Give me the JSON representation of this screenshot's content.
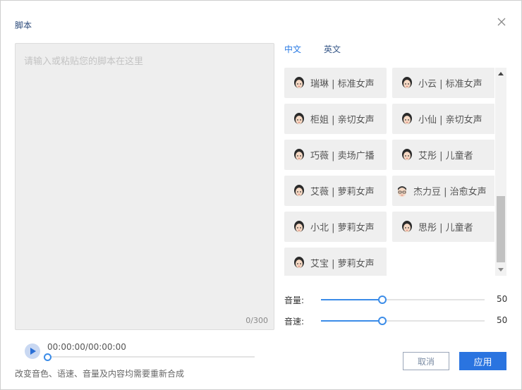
{
  "dialog": {
    "title": "脚本",
    "close_icon": "close-icon"
  },
  "script": {
    "placeholder": "请输入或粘贴您的脚本在这里",
    "value": "",
    "char_count": "0/300"
  },
  "languages": {
    "tabs": [
      "中文",
      "英文"
    ],
    "selected": "中文"
  },
  "voices": [
    {
      "label": "瑞琳 | 标准女声",
      "avatar": "female-avatar-icon"
    },
    {
      "label": "小云 | 标准女声",
      "avatar": "female-avatar-icon"
    },
    {
      "label": "柜姐 | 亲切女声",
      "avatar": "female-avatar-icon"
    },
    {
      "label": "小仙 | 亲切女声",
      "avatar": "female-avatar-icon"
    },
    {
      "label": "巧薇 | 卖场广播",
      "avatar": "female-avatar-icon"
    },
    {
      "label": "艾彤 | 儿童者",
      "avatar": "female-avatar-icon"
    },
    {
      "label": "艾薇 | 萝莉女声",
      "avatar": "female-avatar-icon"
    },
    {
      "label": "杰力豆 | 治愈女声",
      "avatar": "glasses-avatar-icon"
    },
    {
      "label": "小北 | 萝莉女声",
      "avatar": "female-avatar-icon"
    },
    {
      "label": "思彤 | 儿童者",
      "avatar": "female-avatar-icon"
    },
    {
      "label": "艾宝 | 萝莉女声",
      "avatar": "female-avatar-icon"
    }
  ],
  "volume": {
    "label": "音量:",
    "value": "50",
    "level_percent": 50
  },
  "speed": {
    "label": "音速:",
    "value": "50",
    "level_percent": 50
  },
  "player": {
    "time": "00:00:00/00:00:00",
    "progress_percent": 0
  },
  "hint": "改变音色、语速、音量及内容均需要重新合成",
  "buttons": {
    "cancel": "取消",
    "apply": "应用"
  },
  "colors": {
    "accent": "#2a74e0",
    "slider": "#3b8ce8"
  }
}
